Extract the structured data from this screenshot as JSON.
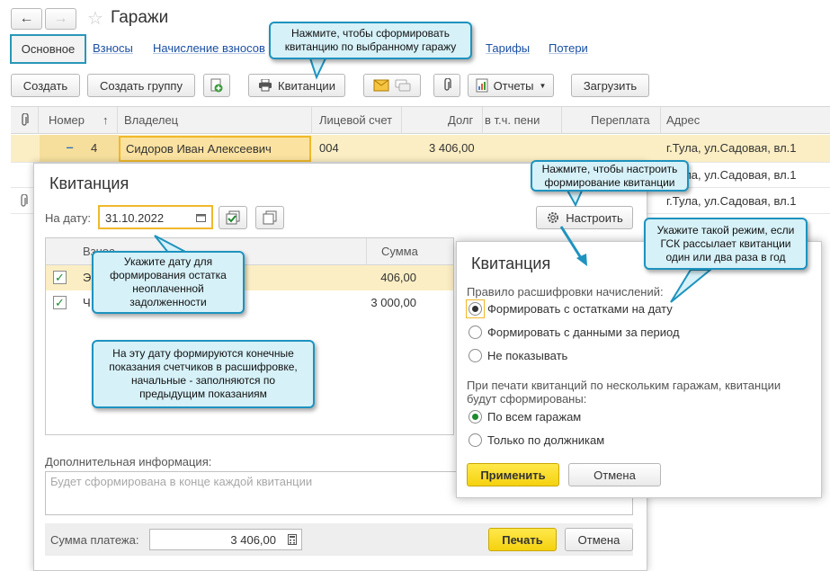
{
  "window": {
    "title": "Гаражи",
    "back_label": "←",
    "forward_label": "→",
    "star_label": "☆"
  },
  "tabs": {
    "active": "Основное",
    "items": [
      "Взносы",
      "Начисление взносов",
      "Тарифы",
      "Потери"
    ]
  },
  "toolbar": {
    "create": "Создать",
    "create_group": "Создать группу",
    "receipts": "Квитанции",
    "reports": "Отчеты",
    "load": "Загрузить"
  },
  "grid": {
    "columns": [
      "Номер",
      "Владелец",
      "Лицевой счет",
      "Долг",
      "в т.ч. пени",
      "Переплата",
      "Адрес"
    ],
    "sort_arrow": "↑",
    "selected_row": {
      "number": "4",
      "owner": "Сидоров Иван Алексеевич",
      "account": "004",
      "debt": "3 406,00",
      "address": "г.Тула, ул.Садовая, вл.1"
    },
    "other_addresses": [
      "г.Тула, ул.Садовая, вл.1",
      "г.Тула, ул.Садовая, вл.1"
    ]
  },
  "receipt_dialog": {
    "title": "Квитанция",
    "date_label": "На дату:",
    "date_value": "31.10.2022",
    "setup_label": "Настроить",
    "table_header_partial": "Взнос",
    "table_header_sum": "Сумма",
    "rows": [
      {
        "name_partial": "Э",
        "sum": "406,00",
        "checked": true
      },
      {
        "name_partial": "Ч",
        "sum": "3 000,00",
        "checked": true
      }
    ],
    "extra_info_label": "Дополнительная информация:",
    "extra_info_placeholder": "Будет сформирована в конце каждой квитанции",
    "payment_sum_label": "Сумма платежа:",
    "payment_sum_value": "3 406,00",
    "print_label": "Печать",
    "cancel_label": "Отмена"
  },
  "settings_dialog": {
    "title": "Квитанция",
    "rule_label": "Правило расшифровки начислений:",
    "rule_options": [
      "Формировать с остатками на дату",
      "Формировать с данными за период",
      "Не показывать"
    ],
    "rule_selected_index": 0,
    "multi_label": "При печати квитанций по нескольким гаражам, квитанции будут сформированы:",
    "multi_options": [
      "По всем гаражам",
      "Только по должникам"
    ],
    "multi_selected_index": 0,
    "apply_label": "Применить",
    "cancel_label": "Отмена"
  },
  "callouts": {
    "receipts_hint": "Нажмите, чтобы сформировать квитанцию по выбранному гаражу",
    "setup_hint": "Нажмите, чтобы настроить формирование квитанции",
    "mode_hint": "Укажите такой режим, если ГСК рассылает квитанции один или два раза в год",
    "date_hint": "Укажите дату для формирования остатка неоплаченной задолженности",
    "meters_hint": "На эту дату формируются конечные показания счетчиков в расшифровке, начальные - заполняются по предыдущим показаниям"
  },
  "colors": {
    "accent_yellow": "#f5d20f",
    "callout_border": "#1e93bf",
    "callout_fill": "#d6f1f8",
    "selection": "#fbeec4",
    "link": "#1a4fa3"
  }
}
